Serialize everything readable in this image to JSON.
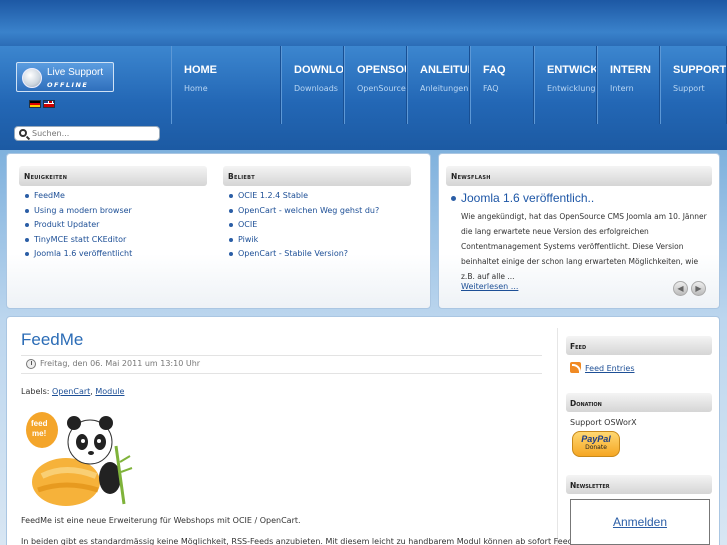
{
  "live_support": {
    "title": "Live Support",
    "status": "OFFLINE"
  },
  "nav": [
    {
      "label": "HOME",
      "sub": "Home"
    },
    {
      "label": "DOWNLOADS",
      "sub": "Downloads"
    },
    {
      "label": "OPENSOURCE",
      "sub": "OpenSource"
    },
    {
      "label": "ANLEITUNGEN",
      "sub": "Anleitungen"
    },
    {
      "label": "FAQ",
      "sub": "FAQ"
    },
    {
      "label": "ENTWICKLUNG",
      "sub": "Entwicklung"
    },
    {
      "label": "INTERN",
      "sub": "Intern"
    },
    {
      "label": "SUPPORT",
      "sub": "Support"
    }
  ],
  "search": {
    "placeholder": "Suchen..."
  },
  "neuigkeiten": {
    "title": "Neuigkeiten",
    "items": [
      "FeedMe",
      "Using a modern browser",
      "Produkt Updater",
      "TinyMCE statt CKEditor",
      "Joomla 1.6 veröffentlicht"
    ]
  },
  "beliebt": {
    "title": "Beliebt",
    "items": [
      "OCIE 1.2.4 Stable",
      "OpenCart - welchen Weg gehst du?",
      "OCIE",
      "Piwik",
      "OpenCart - Stabile Version?"
    ]
  },
  "newsflash": {
    "title": "Newsflash",
    "headline": "Joomla 1.6 veröffentlich..",
    "text": "Wie angekündigt, hat das OpenSource CMS Joomla am 10. Jänner die lang erwartete neue Version des erfolgreichen Contentmanagement Systems veröffentlicht. Diese Version beinhaltet einige der schon lang erwarteten Möglichkeiten, wie z.B. auf alle ...",
    "more": "Weiterlesen ..."
  },
  "article": {
    "title": "FeedMe",
    "date": "Freitag, den 06. Mai 2011 um 13:10 Uhr",
    "labels_prefix": "Labels:",
    "labels": [
      "OpenCart",
      "Module"
    ],
    "image_text": "feed me!",
    "para1": "FeedMe ist eine neue Erweiterung für Webshops mit OCIE / OpenCart.",
    "para2": "In beiden gibt es standardmässig keine Möglichkeit, RSS-Feeds anzubieten. Mit diesem leicht zu handbarem Modul können ab sofort Feeds"
  },
  "sidebar": {
    "feed_title": "Feed",
    "feed_link": "Feed Entries",
    "donation_title": "Donation",
    "donation_text": "Support OSWorX",
    "paypal_word": "PayPal",
    "paypal_sub": "Donate",
    "newsletter_title": "Newsletter",
    "newsletter_link": "Anmelden"
  }
}
